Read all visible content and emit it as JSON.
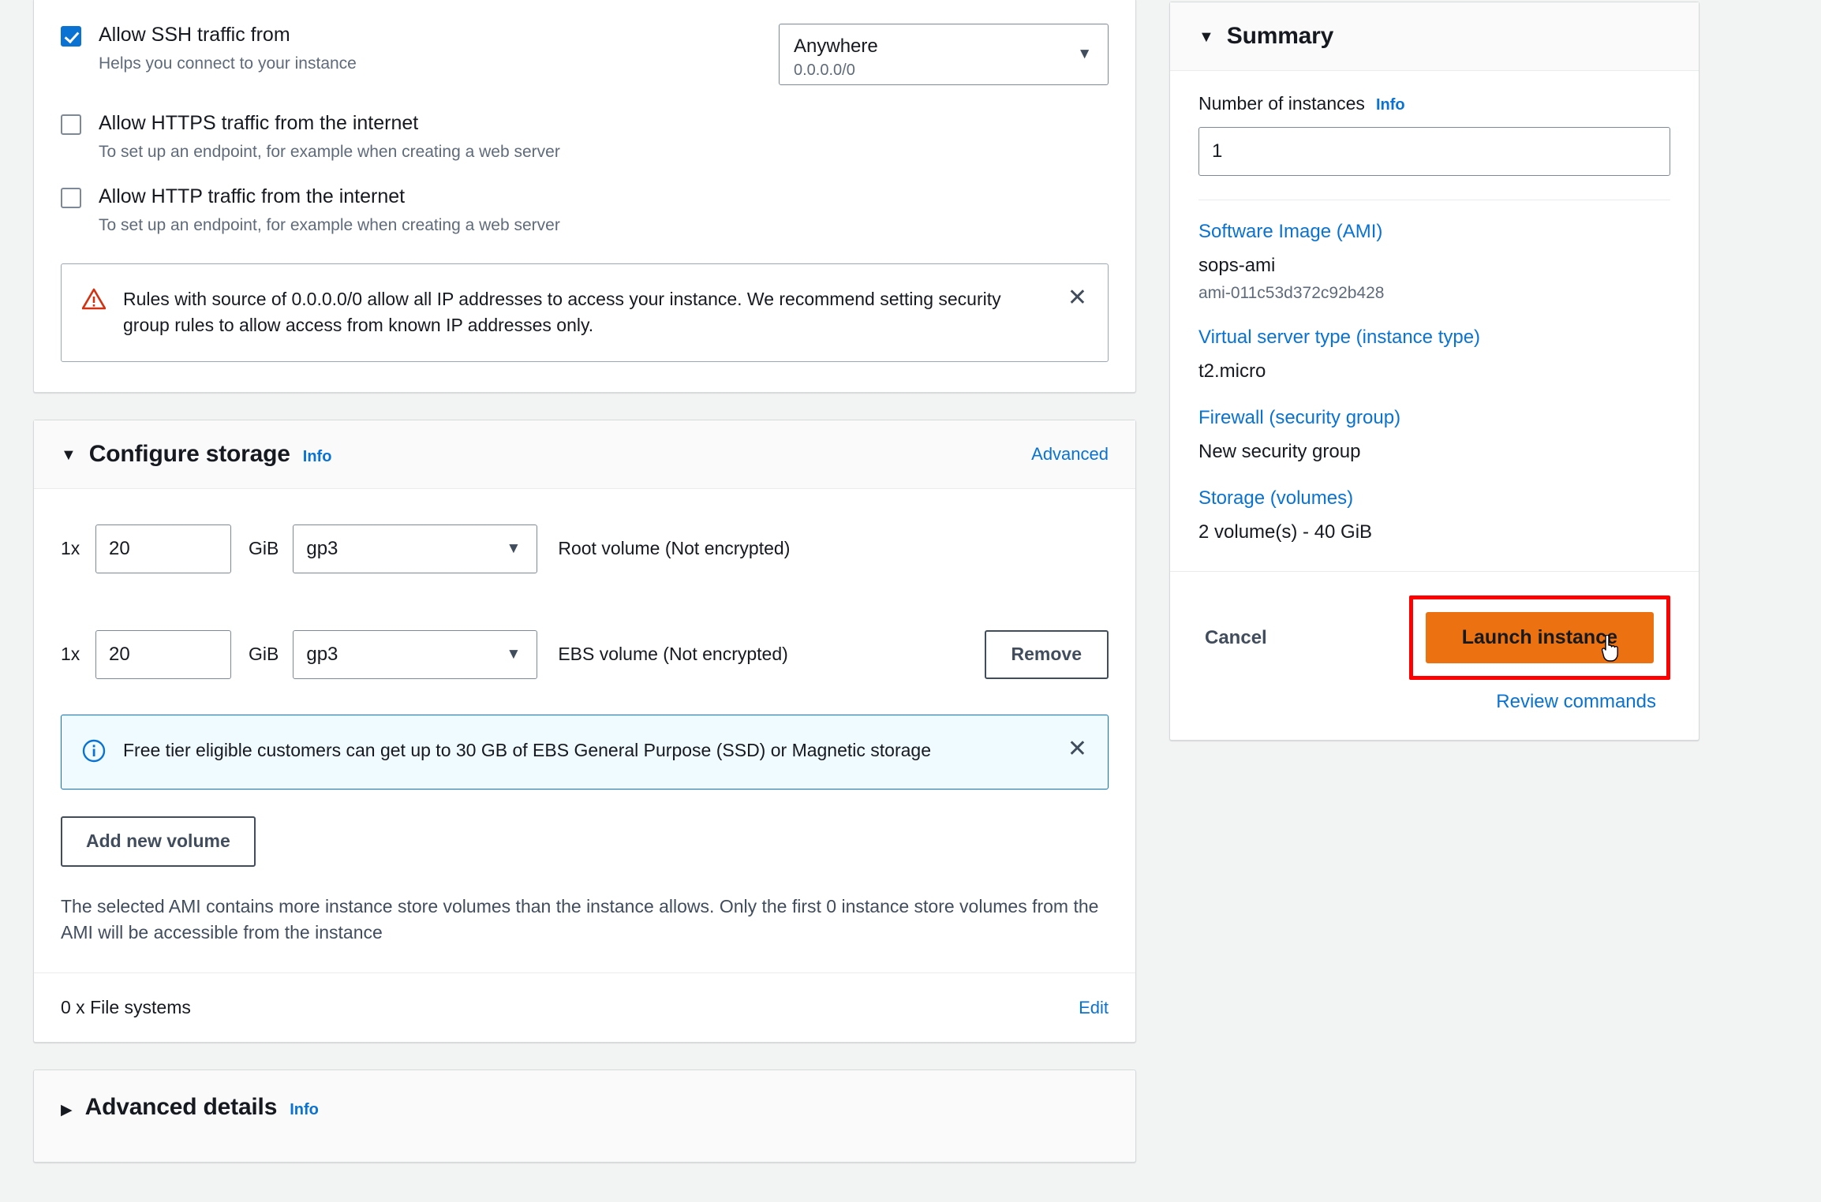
{
  "security_group": {
    "rules": [
      {
        "label": "Allow SSH traffic from",
        "description": "Helps you connect to your instance",
        "checked": true,
        "source_main": "Anywhere",
        "source_sub": "0.0.0.0/0"
      },
      {
        "label": "Allow HTTPS traffic from the internet",
        "description": "To set up an endpoint, for example when creating a web server",
        "checked": false
      },
      {
        "label": "Allow HTTP traffic from the internet",
        "description": "To set up an endpoint, for example when creating a web server",
        "checked": false
      }
    ],
    "warning": {
      "icon": "warning-triangle-icon",
      "text": "Rules with source of 0.0.0.0/0 allow all IP addresses to access your instance. We recommend setting security group rules to allow access from known IP addresses only.",
      "close_label": "✕"
    }
  },
  "storage": {
    "title": "Configure storage",
    "info_label": "Info",
    "advanced_label": "Advanced",
    "caret": "▼",
    "volumes": [
      {
        "count": "1x",
        "size": "20",
        "unit": "GiB",
        "type": "gp3",
        "description": "Root volume  (Not encrypted)",
        "removable": false
      },
      {
        "count": "1x",
        "size": "20",
        "unit": "GiB",
        "type": "gp3",
        "description": "EBS volume  (Not encrypted)",
        "removable": true,
        "remove_label": "Remove"
      }
    ],
    "free_tier_notice": {
      "icon": "info-circle-icon",
      "text": "Free tier eligible customers can get up to 30 GB of EBS General Purpose (SSD) or Magnetic storage",
      "close_label": "✕"
    },
    "add_volume_label": "Add new volume",
    "note": "The selected AMI contains more instance store volumes than the instance allows. Only the first 0 instance store volumes from the AMI will be accessible from the instance",
    "file_systems_label": "0 x File systems",
    "file_systems_edit_label": "Edit"
  },
  "advanced_details": {
    "title": "Advanced details",
    "info_label": "Info",
    "caret": "▶"
  },
  "summary": {
    "title": "Summary",
    "caret": "▼",
    "number_of_instances": {
      "label": "Number of instances",
      "info_label": "Info",
      "value": "1"
    },
    "groups": [
      {
        "link": "Software Image (AMI)",
        "value": "sops-ami",
        "sub": "ami-011c53d372c92b428"
      },
      {
        "link": "Virtual server type (instance type)",
        "value": "t2.micro",
        "sub": ""
      },
      {
        "link": "Firewall (security group)",
        "value": "New security group",
        "sub": ""
      },
      {
        "link": "Storage (volumes)",
        "value": "2 volume(s) - 40 GiB",
        "sub": ""
      }
    ],
    "cancel_label": "Cancel",
    "launch_label": "Launch instance",
    "review_label": "Review commands"
  },
  "colors": {
    "link_blue": "#0972d3",
    "launch_orange": "#ec7211",
    "highlight_red": "#ff0000",
    "warning_red": "#d13212",
    "info_bg": "#f0fbff"
  }
}
